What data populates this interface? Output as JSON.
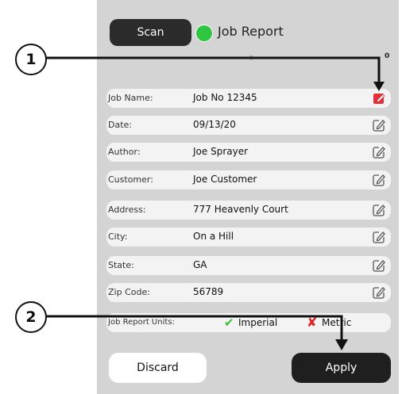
{
  "header": {
    "scan_label": "Scan",
    "title": "Job Report",
    "status_color": "#2ec540",
    "partial_text": "g",
    "corner_value": "0"
  },
  "fields": [
    {
      "label": "Job Name:",
      "value": "Job No 12345",
      "edit_icon": "edit-icon",
      "active": true
    },
    {
      "label": "Date:",
      "value": "09/13/20",
      "edit_icon": "edit-icon"
    },
    {
      "label": "Author:",
      "value": "Joe Sprayer",
      "edit_icon": "edit-icon"
    },
    {
      "label": "Customer:",
      "value": "Joe Customer",
      "edit_icon": "edit-icon"
    },
    {
      "label": "Address:",
      "value": "777 Heavenly Court",
      "edit_icon": "edit-icon"
    },
    {
      "label": "City:",
      "value": "On a Hill",
      "edit_icon": "edit-icon"
    },
    {
      "label": "State:",
      "value": "GA",
      "edit_icon": "edit-icon"
    },
    {
      "label": "Zip Code:",
      "value": "56789",
      "edit_icon": "edit-icon"
    }
  ],
  "units": {
    "label": "Job Report Units:",
    "imperial_label": "Imperial",
    "metric_label": "Metric",
    "selected": "Imperial",
    "check_icon": "✔",
    "x_icon": "✘"
  },
  "footer": {
    "discard_label": "Discard",
    "apply_label": "Apply"
  },
  "callouts": [
    {
      "number": "1",
      "target": "job-name-edit"
    },
    {
      "number": "2",
      "target": "apply-button"
    }
  ],
  "colors": {
    "panel": "#d4d4d4",
    "row": "#f3f3f3",
    "dark_button": "#2b2b2b",
    "active_edit": "#e0303a",
    "edit": "#555555"
  }
}
